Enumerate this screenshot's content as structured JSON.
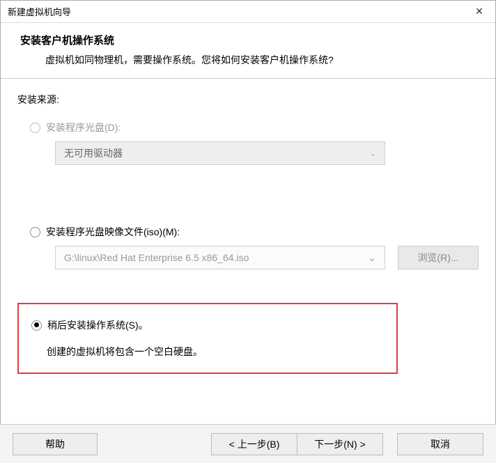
{
  "window": {
    "title": "新建虚拟机向导"
  },
  "header": {
    "title": "安装客户机操作系统",
    "description": "虚拟机如同物理机，需要操作系统。您将如何安装客户机操作系统?"
  },
  "source": {
    "label": "安装来源:"
  },
  "option_disc": {
    "label": "安装程序光盘(D):",
    "dropdown_value": "无可用驱动器"
  },
  "option_iso": {
    "label": "安装程序光盘映像文件(iso)(M):",
    "path": "G:\\linux\\Red Hat Enterprise 6.5 x86_64.iso",
    "browse_label": "浏览(R)..."
  },
  "option_later": {
    "label": "稍后安装操作系统(S)。",
    "description": "创建的虚拟机将包含一个空白硬盘。"
  },
  "footer": {
    "help": "帮助",
    "back": "< 上一步(B)",
    "next": "下一步(N) >",
    "cancel": "取消"
  }
}
